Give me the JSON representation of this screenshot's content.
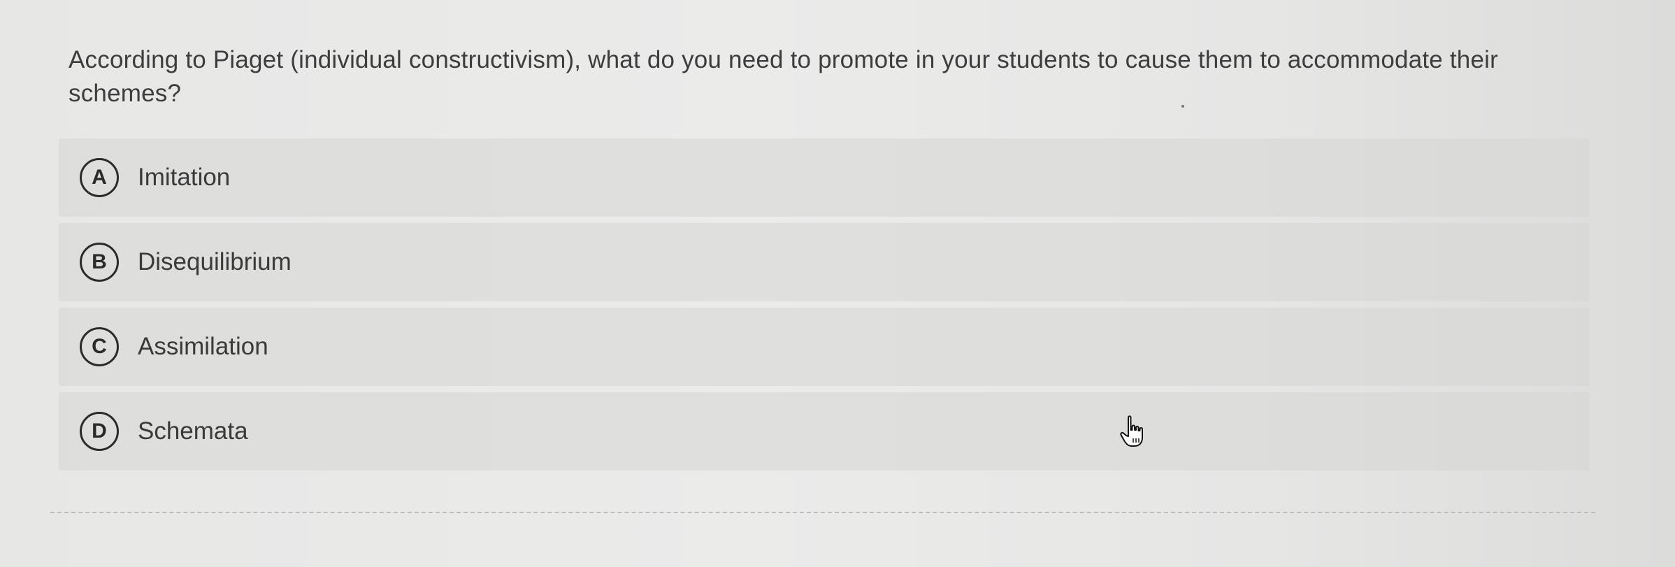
{
  "question": {
    "text": "According to Piaget (individual constructivism), what do you need to promote in your students to cause them to accommodate their schemes?"
  },
  "options": [
    {
      "letter": "A",
      "label": "Imitation"
    },
    {
      "letter": "B",
      "label": "Disequilibrium"
    },
    {
      "letter": "C",
      "label": "Assimilation"
    },
    {
      "letter": "D",
      "label": "Schemata"
    }
  ],
  "cursor": {
    "icon": "hand-pointer-icon"
  },
  "colors": {
    "background": "#e9e9e8",
    "option_background": "#d8d8d6",
    "text": "#3a3a3a",
    "letter_border": "#2b2b2b"
  }
}
